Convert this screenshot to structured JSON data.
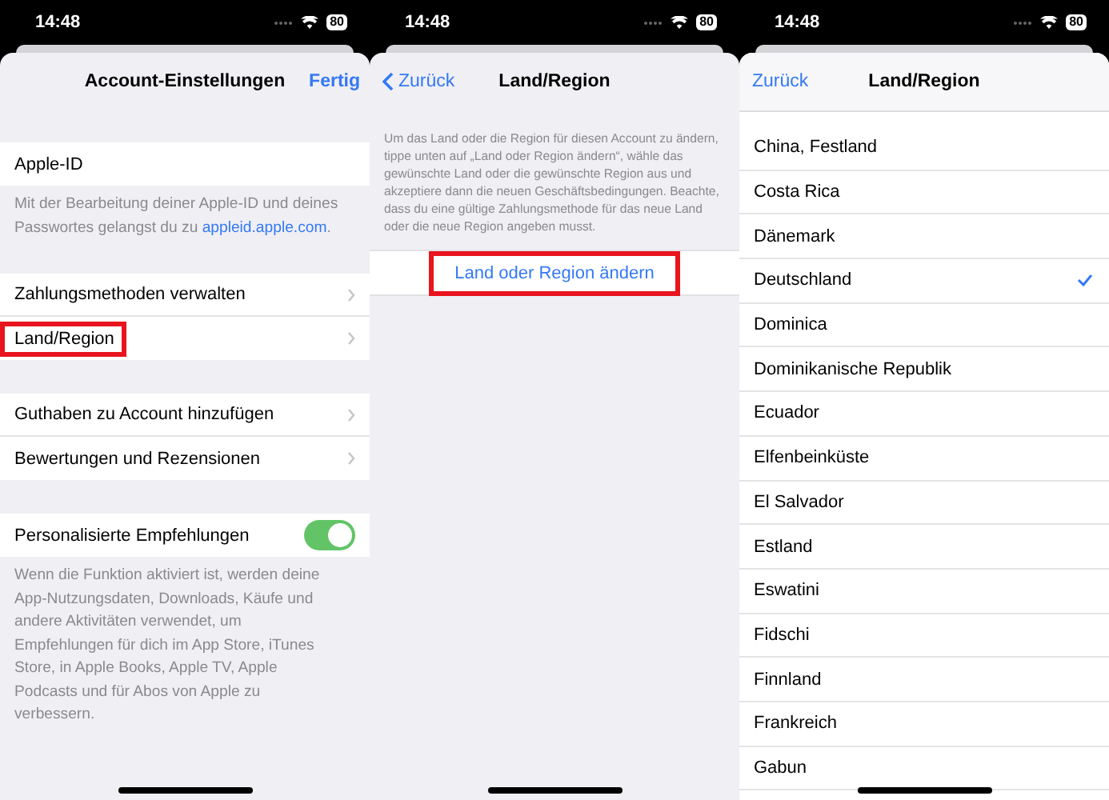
{
  "screens": [
    {
      "status_bar": {
        "time": "14:48",
        "battery": "80"
      },
      "nav": {
        "title": "Account-Einstellungen",
        "action": "Fertig"
      },
      "kind": "settings",
      "sections": [
        {
          "rows": [
            {
              "kind": "plain",
              "label": "Apple-ID",
              "highlighted": false
            }
          ],
          "footer": "Mit der Bearbeitung deiner Apple-ID und deines Passwortes gelangst du zu ",
          "footer_link": "appleid.apple.com",
          "footer_end": "."
        },
        {
          "rows": [
            {
              "kind": "chevron",
              "label": "Zahlungsmethoden verwalten",
              "highlighted": false
            },
            {
              "kind": "chevron",
              "label": "Land/Region",
              "highlighted": true
            }
          ]
        },
        {
          "rows": [
            {
              "kind": "chevron",
              "label": "Guthaben zu Account hinzufügen",
              "highlighted": false
            },
            {
              "kind": "chevron",
              "label": "Bewertungen und Rezensionen",
              "highlighted": false
            }
          ]
        },
        {
          "rows": [
            {
              "kind": "toggle",
              "label": "Personalisierte Empfehlungen",
              "on": true,
              "highlighted": false
            }
          ],
          "footer": "Wenn die Funktion aktiviert ist, werden deine App-Nutzungsdaten, Downloads, Käufe und andere Aktivitäten verwendet, um Empfehlungen für dich im App Store, iTunes Store, in Apple Books, Apple TV, Apple Podcasts und für Abos von Apple zu verbessern."
        }
      ]
    },
    {
      "status_bar": {
        "time": "14:48",
        "battery": "80"
      },
      "nav": {
        "title": "Land/Region",
        "back": "Zurück",
        "back_chevron": true
      },
      "kind": "info",
      "description": "Um das Land oder die Region für diesen Account zu ändern, tippe unten auf „Land oder Region ändern“, wähle das gewünschte Land oder die gewünschte Region aus und akzeptiere dann die neuen Geschäftsbedingungen. Beachte, dass du eine gültige Zahlungsmethode für das neue Land oder die neue Region angeben musst.",
      "action": {
        "label": "Land oder Region ändern",
        "highlighted": true
      }
    },
    {
      "status_bar": {
        "time": "14:48",
        "battery": "80"
      },
      "nav": {
        "title": "Land/Region",
        "back": "Zurück",
        "back_chevron": false
      },
      "kind": "list",
      "items": [
        {
          "label": "China, Festland",
          "selected": false
        },
        {
          "label": "Costa Rica",
          "selected": false
        },
        {
          "label": "Dänemark",
          "selected": false
        },
        {
          "label": "Deutschland",
          "selected": true
        },
        {
          "label": "Dominica",
          "selected": false
        },
        {
          "label": "Dominikanische Republik",
          "selected": false
        },
        {
          "label": "Ecuador",
          "selected": false
        },
        {
          "label": "Elfenbeinküste",
          "selected": false
        },
        {
          "label": "El Salvador",
          "selected": false
        },
        {
          "label": "Estland",
          "selected": false
        },
        {
          "label": "Eswatini",
          "selected": false
        },
        {
          "label": "Fidschi",
          "selected": false
        },
        {
          "label": "Finnland",
          "selected": false
        },
        {
          "label": "Frankreich",
          "selected": false
        },
        {
          "label": "Gabun",
          "selected": false
        }
      ]
    }
  ]
}
